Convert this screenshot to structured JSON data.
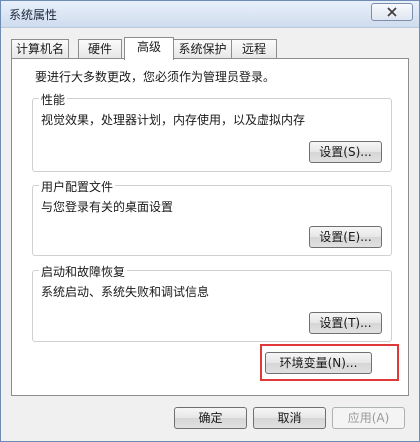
{
  "window": {
    "title": "系统属性"
  },
  "tabs": [
    {
      "label": "计算机名"
    },
    {
      "label": "硬件"
    },
    {
      "label": "高级"
    },
    {
      "label": "系统保护"
    },
    {
      "label": "远程"
    }
  ],
  "active_tab": "高级",
  "admin_note": "要进行大多数更改，您必须作为管理员登录。",
  "groups": {
    "performance": {
      "title": "性能",
      "description": "视觉效果，处理器计划，内存使用，以及虚拟内存",
      "button": "设置(S)..."
    },
    "user_profiles": {
      "title": "用户配置文件",
      "description": "与您登录有关的桌面设置",
      "button": "设置(E)..."
    },
    "startup_recovery": {
      "title": "启动和故障恢复",
      "description": "系统启动、系统失败和调试信息",
      "button": "设置(T)..."
    }
  },
  "env_button": "环境变量(N)...",
  "footer": {
    "ok": "确定",
    "cancel": "取消",
    "apply": "应用(A)"
  },
  "colors": {
    "highlight": "#e0393a",
    "title_gradient_top": "#e8f0fa",
    "title_gradient_bottom": "#cfdcee"
  }
}
